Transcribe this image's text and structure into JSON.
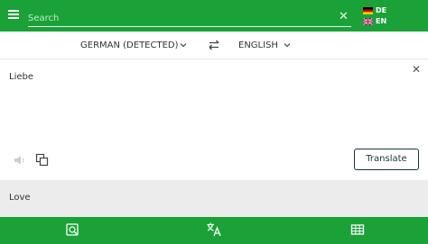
{
  "topbar": {
    "search_placeholder": "Search",
    "search_value": "",
    "clear_symbol": "✕",
    "lang_from_code": "DE",
    "lang_to_code": "EN",
    "accent_color": "#1aa238"
  },
  "lang_bar": {
    "source_language": "GERMAN (DETECTED)",
    "target_language": "ENGLISH"
  },
  "input": {
    "text": "Liebe",
    "clear_symbol": "✕",
    "translate_label": "Translate"
  },
  "output": {
    "text": "Love"
  },
  "icons": {
    "menu": "menu-icon",
    "speaker": "speaker-icon",
    "copy": "copy-icon",
    "swap": "swap-icon",
    "nav_camera": "camera-search-icon",
    "nav_translate": "translate-icon",
    "nav_phrasebook": "phrasebook-icon"
  }
}
